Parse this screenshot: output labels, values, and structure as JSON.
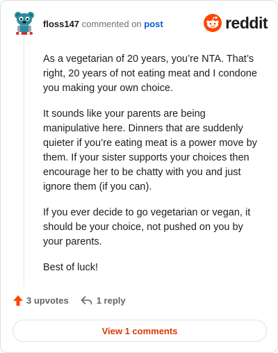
{
  "header": {
    "username": "floss147",
    "action_text": "commented on",
    "post_link": "post",
    "brand_name": "reddit",
    "avatar_icon": "snoo-avatar-icon",
    "brand_icon": "reddit-logo-icon"
  },
  "comment": {
    "paragraphs": [
      "As a vegetarian of 20 years, you’re NTA. That’s right, 20 years of not eating meat and I condone you making your own choice.",
      "It sounds like your parents are being manipulative here. Dinners that are suddenly quieter if you’re eating meat is a power move by them. If your sister supports your choices then encourage her to be chatty with you and just ignore them (if you can).",
      "If you ever decide to go vegetarian or vegan, it should be your choice, not pushed on you by your parents.",
      "Best of luck!"
    ]
  },
  "actions": {
    "upvotes_label": "3 upvotes",
    "reply_label": "1 reply",
    "upvote_icon": "upvote-arrow-icon",
    "reply_icon": "reply-arrow-icon"
  },
  "footer": {
    "view_comments_label": "View 1 comments"
  },
  "colors": {
    "accent": "#ff4500",
    "link": "#0a5bd3",
    "view_button_text": "#d93a00",
    "avatar_teal": "#2a8fa0"
  }
}
